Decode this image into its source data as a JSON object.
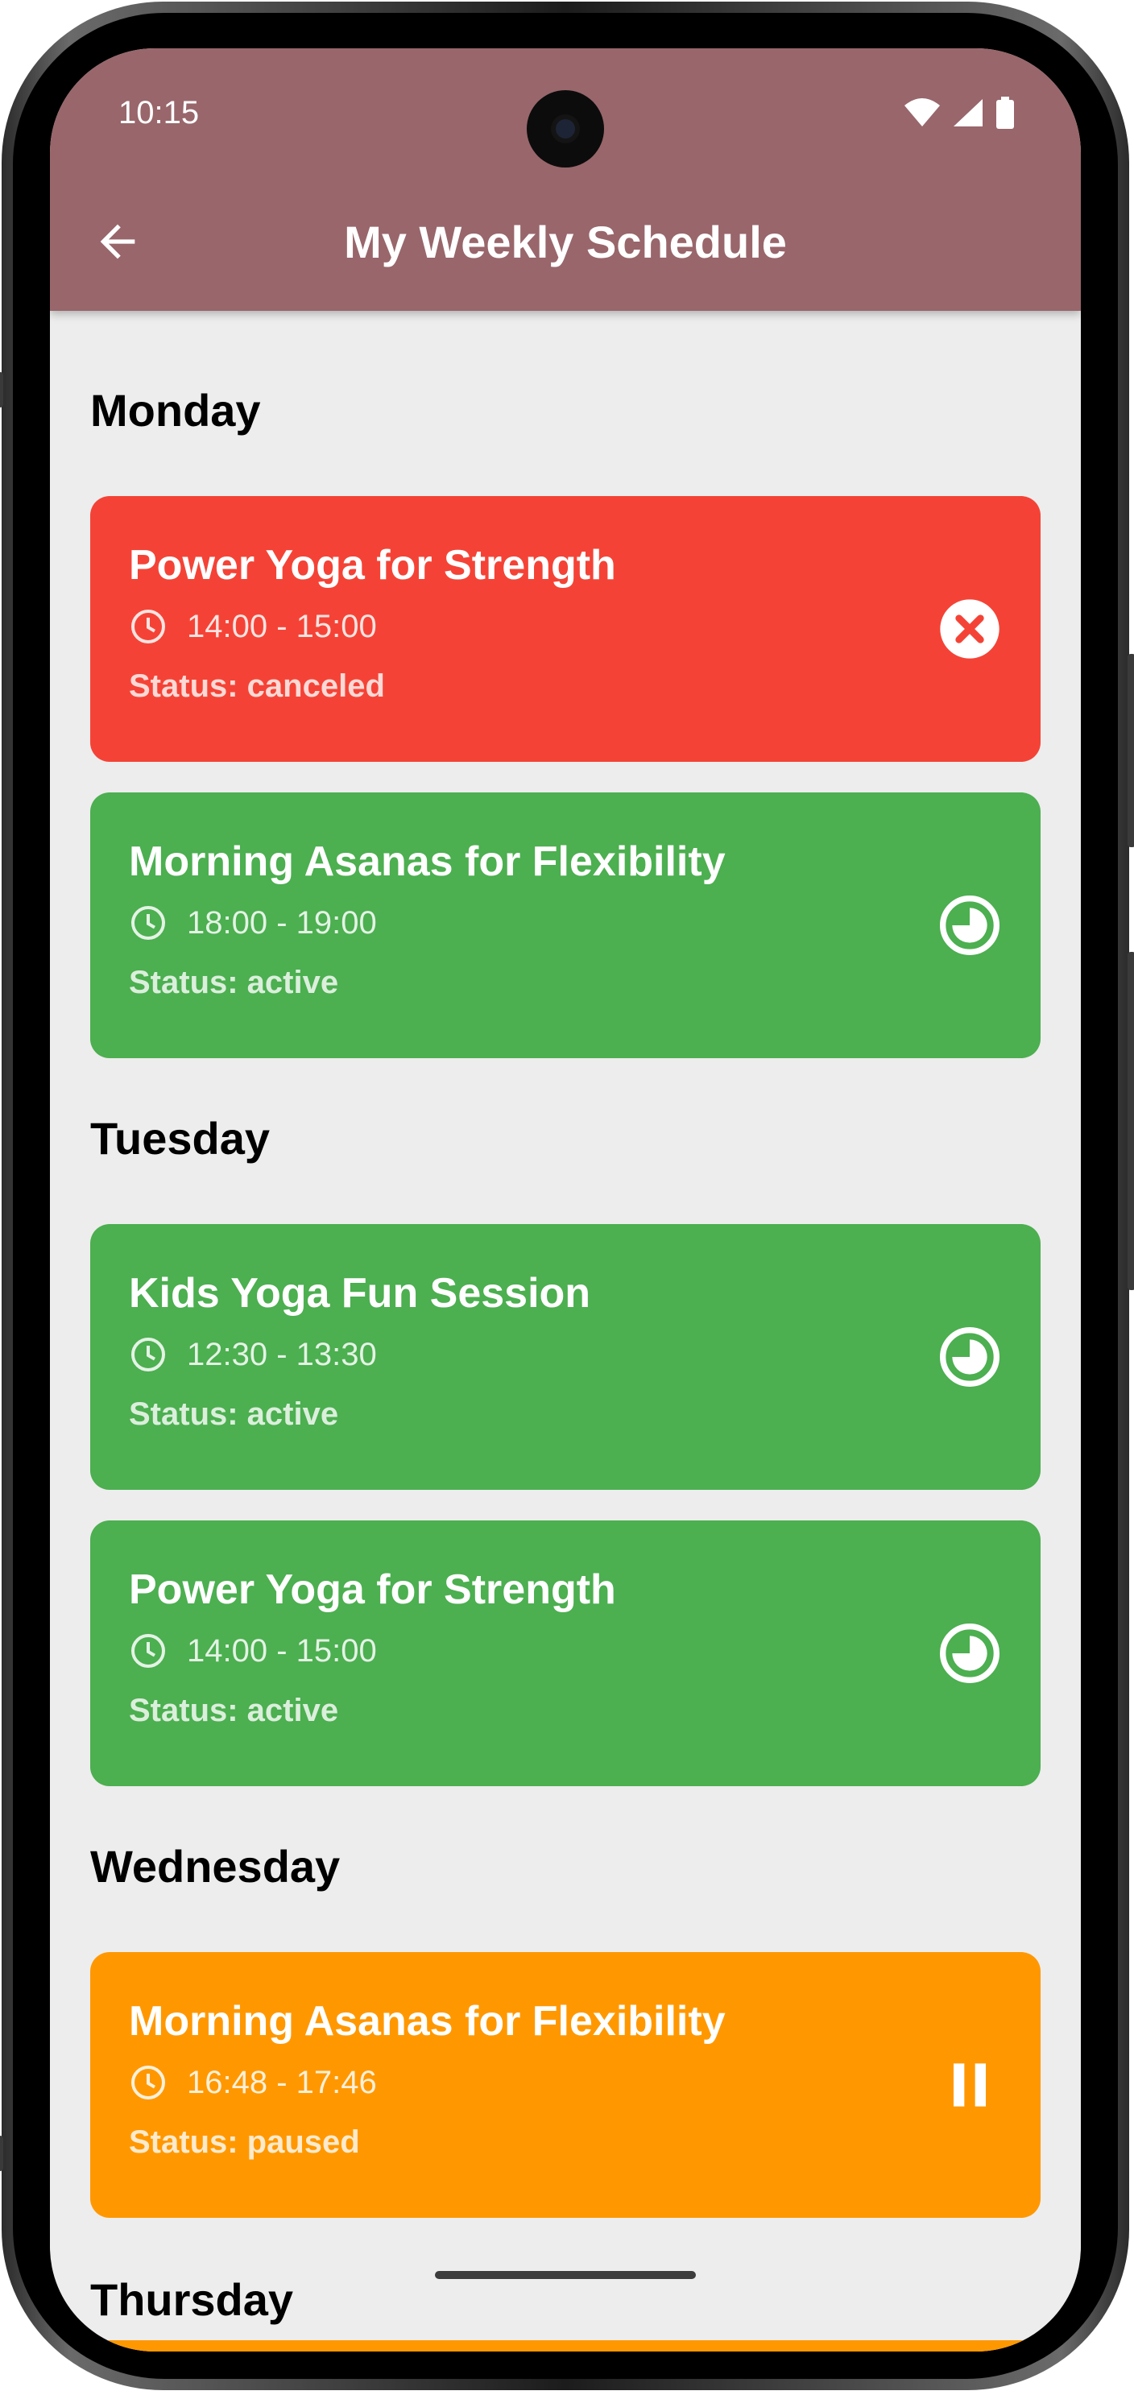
{
  "status_bar": {
    "time": "10:15",
    "icons": [
      "wifi-icon",
      "signal-icon",
      "battery-icon"
    ]
  },
  "app_bar": {
    "title": "My Weekly Schedule",
    "back_icon": "arrow-left-icon",
    "color": "#98666b"
  },
  "colors": {
    "canceled": "#f44336",
    "active": "#4caf50",
    "paused": "#ff9800",
    "background": "#ededed"
  },
  "days": [
    {
      "name": "Monday",
      "sessions": [
        {
          "title": "Power Yoga for Strength",
          "time": "14:00 - 15:00",
          "status_text": "Status: canceled",
          "status": "canceled",
          "icon": "cancel-circle-icon"
        },
        {
          "title": "Morning Asanas for Flexibility",
          "time": "18:00 - 19:00",
          "status_text": "Status: active",
          "status": "active",
          "icon": "timelapse-icon"
        }
      ]
    },
    {
      "name": "Tuesday",
      "sessions": [
        {
          "title": "Kids Yoga Fun Session",
          "time": "12:30 - 13:30",
          "status_text": "Status: active",
          "status": "active",
          "icon": "timelapse-icon"
        },
        {
          "title": "Power Yoga for Strength",
          "time": "14:00 - 15:00",
          "status_text": "Status: active",
          "status": "active",
          "icon": "timelapse-icon"
        }
      ]
    },
    {
      "name": "Wednesday",
      "sessions": [
        {
          "title": "Morning Asanas for Flexibility",
          "time": "16:48 - 17:46",
          "status_text": "Status: paused",
          "status": "paused",
          "icon": "pause-icon"
        }
      ]
    },
    {
      "name": "Thursday",
      "sessions": []
    }
  ]
}
